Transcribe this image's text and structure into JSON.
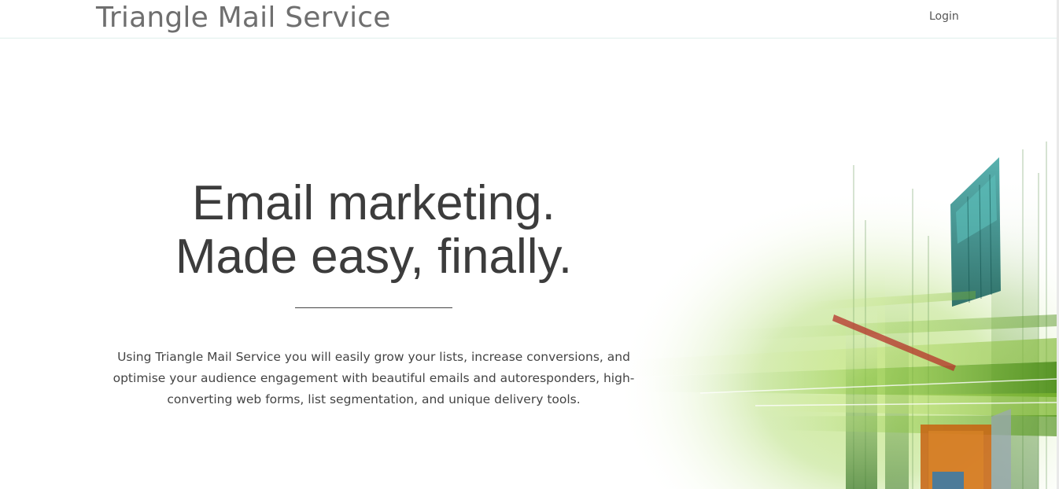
{
  "navbar": {
    "brand": "Triangle Mail Service",
    "login_label": "Login"
  },
  "hero": {
    "headline_line1": "Email marketing.",
    "headline_line2": "Made easy, finally.",
    "description": "Using Triangle Mail Service you will easily grow your lists, increase conversions, and optimise your audience engagement with beautiful emails and autoresponders, high-converting web forms, list segmentation, and unique delivery tools."
  },
  "colors": {
    "text_dark": "#3c3c3c",
    "brand_gray": "#6f6f6f",
    "accent_green": "#6aa82a",
    "accent_teal": "#1f7a78",
    "accent_orange": "#c8620f"
  },
  "icons": {
    "hero_art": "abstract-green-fractal-image"
  }
}
